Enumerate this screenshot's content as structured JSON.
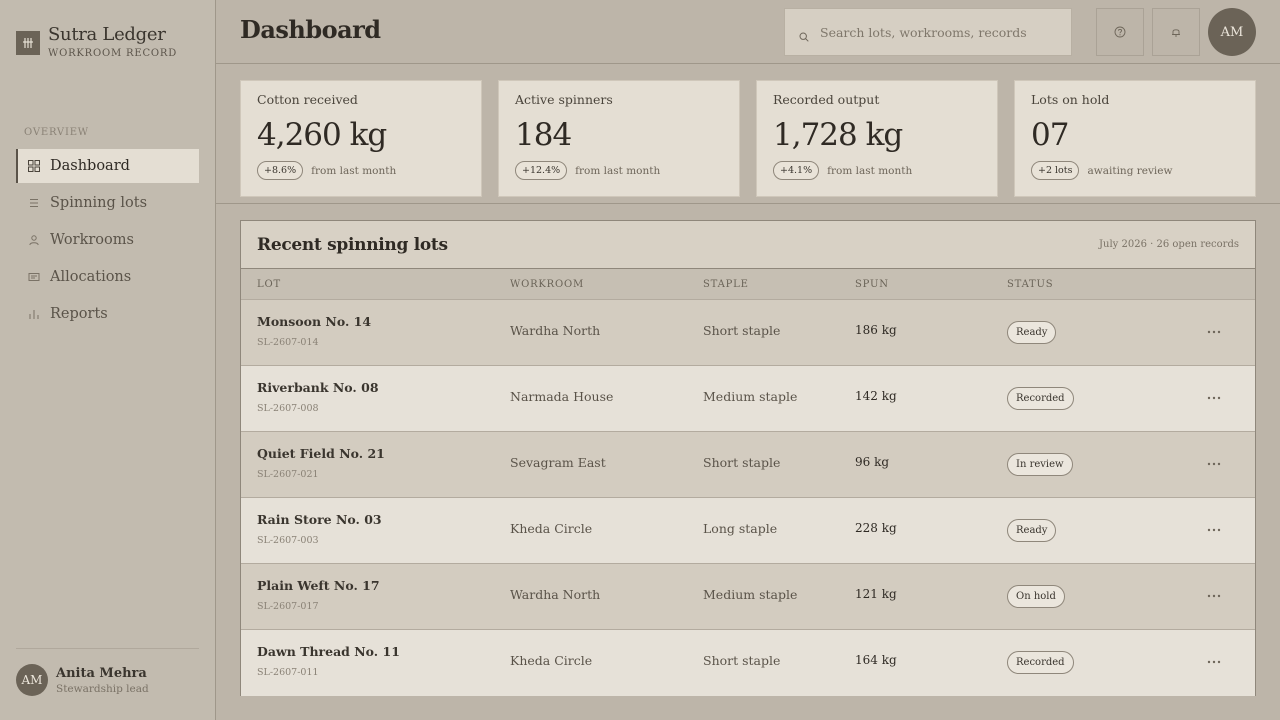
{
  "brand": {
    "title": "Sutra Ledger",
    "subtitle": "WORKROOM RECORD"
  },
  "sidebar": {
    "section": "OVERVIEW",
    "items": [
      {
        "label": "Dashboard",
        "icon": "grid-icon",
        "active": true
      },
      {
        "label": "Spinning lots",
        "icon": "list-icon"
      },
      {
        "label": "Workrooms",
        "icon": "person-icon"
      },
      {
        "label": "Allocations",
        "icon": "ledger-icon"
      },
      {
        "label": "Reports",
        "icon": "bar-chart-icon"
      }
    ],
    "user": {
      "initials": "AM",
      "name": "Anita Mehra",
      "role": "Stewardship lead"
    }
  },
  "header": {
    "title": "Dashboard",
    "search_placeholder": "Search lots, workrooms, records",
    "avatar_initials": "AM"
  },
  "stats": [
    {
      "label": "Cotton received",
      "value": "4,260 kg",
      "badge": "+8.6%",
      "note": "from last month"
    },
    {
      "label": "Active spinners",
      "value": "184",
      "badge": "+12.4%",
      "note": "from last month"
    },
    {
      "label": "Recorded output",
      "value": "1,728 kg",
      "badge": "+4.1%",
      "note": "from last month"
    },
    {
      "label": "Lots on hold",
      "value": "07",
      "badge": "+2 lots",
      "note": "awaiting review"
    }
  ],
  "table": {
    "title": "Recent spinning lots",
    "meta": "July 2026 · 26 open records",
    "columns": {
      "lot": "LOT",
      "workroom": "WORKROOM",
      "staple": "STAPLE",
      "spun": "SPUN",
      "status": "STATUS"
    },
    "rows": [
      {
        "name": "Monsoon No. 14",
        "code": "SL-2607-014",
        "workroom": "Wardha North",
        "staple": "Short staple",
        "spun": "186 kg",
        "status": "Ready"
      },
      {
        "name": "Riverbank No. 08",
        "code": "SL-2607-008",
        "workroom": "Narmada House",
        "staple": "Medium staple",
        "spun": "142 kg",
        "status": "Recorded"
      },
      {
        "name": "Quiet Field No. 21",
        "code": "SL-2607-021",
        "workroom": "Sevagram East",
        "staple": "Short staple",
        "spun": "96 kg",
        "status": "In review"
      },
      {
        "name": "Rain Store No. 03",
        "code": "SL-2607-003",
        "workroom": "Kheda Circle",
        "staple": "Long staple",
        "spun": "228 kg",
        "status": "Ready"
      },
      {
        "name": "Plain Weft No. 17",
        "code": "SL-2607-017",
        "workroom": "Wardha North",
        "staple": "Medium staple",
        "spun": "121 kg",
        "status": "On hold"
      },
      {
        "name": "Dawn Thread No. 11",
        "code": "SL-2607-011",
        "workroom": "Kheda Circle",
        "staple": "Short staple",
        "spun": "164 kg",
        "status": "Recorded"
      }
    ]
  },
  "colors": {
    "accent": "#6b6357",
    "background": "#bdb5a9",
    "card": "#e4ded3"
  }
}
